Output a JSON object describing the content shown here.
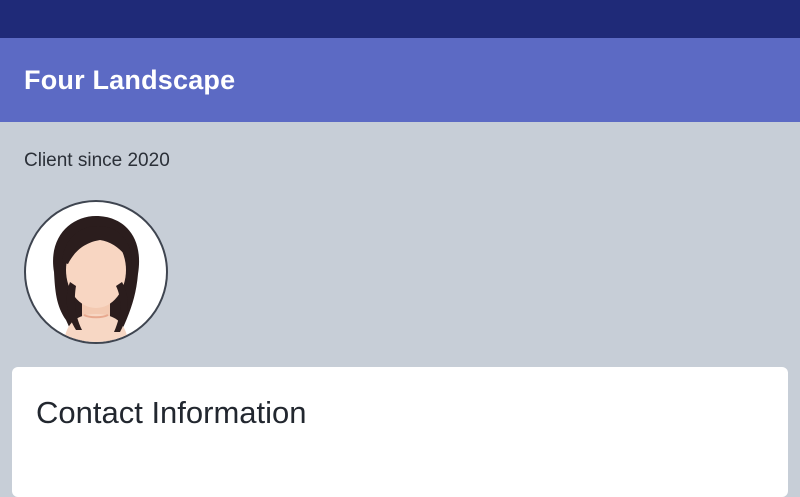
{
  "app": {
    "title": "Four Landscape"
  },
  "profile": {
    "client_since": "Client since 2020",
    "avatar_icon": "user-avatar-female"
  },
  "card": {
    "title": "Contact Information"
  },
  "colors": {
    "status_bar": "#1f2a78",
    "app_bar": "#5c6ac4",
    "background": "#c7ced7",
    "card": "#ffffff"
  }
}
